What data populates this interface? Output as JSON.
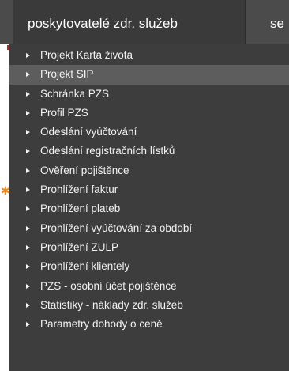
{
  "topnav": {
    "active_tab": "poskytovatelé zdr. služeb",
    "next_tab_partial": "se"
  },
  "menu": {
    "highlighted_index": 1,
    "items": [
      {
        "label": "Projekt Karta života"
      },
      {
        "label": "Projekt SIP"
      },
      {
        "label": "Schránka PZS"
      },
      {
        "label": "Profil PZS"
      },
      {
        "label": "Odeslání vyúčtování"
      },
      {
        "label": "Odeslání registračních lístků"
      },
      {
        "label": "Ověření pojištěnce"
      },
      {
        "label": "Prohlížení faktur"
      },
      {
        "label": "Prohlížení plateb"
      },
      {
        "label": "Prohlížení vyúčtování za období"
      },
      {
        "label": "Prohlížení ZULP"
      },
      {
        "label": "Prohlížení klientely"
      },
      {
        "label": "PZS - osobní účet pojištěnce"
      },
      {
        "label": "Statistiky - náklady zdr. služeb"
      },
      {
        "label": "Parametry dohody o ceně"
      }
    ],
    "bullet_icon": "triangle-right-icon"
  },
  "colors": {
    "topbar_bg": "#4b4b4b",
    "active_tab_bg": "#3a3a3a",
    "menu_bg": "#3d3d3d",
    "menu_highlight_bg": "#5d5d5d",
    "menu_text": "#f2f2f2"
  }
}
